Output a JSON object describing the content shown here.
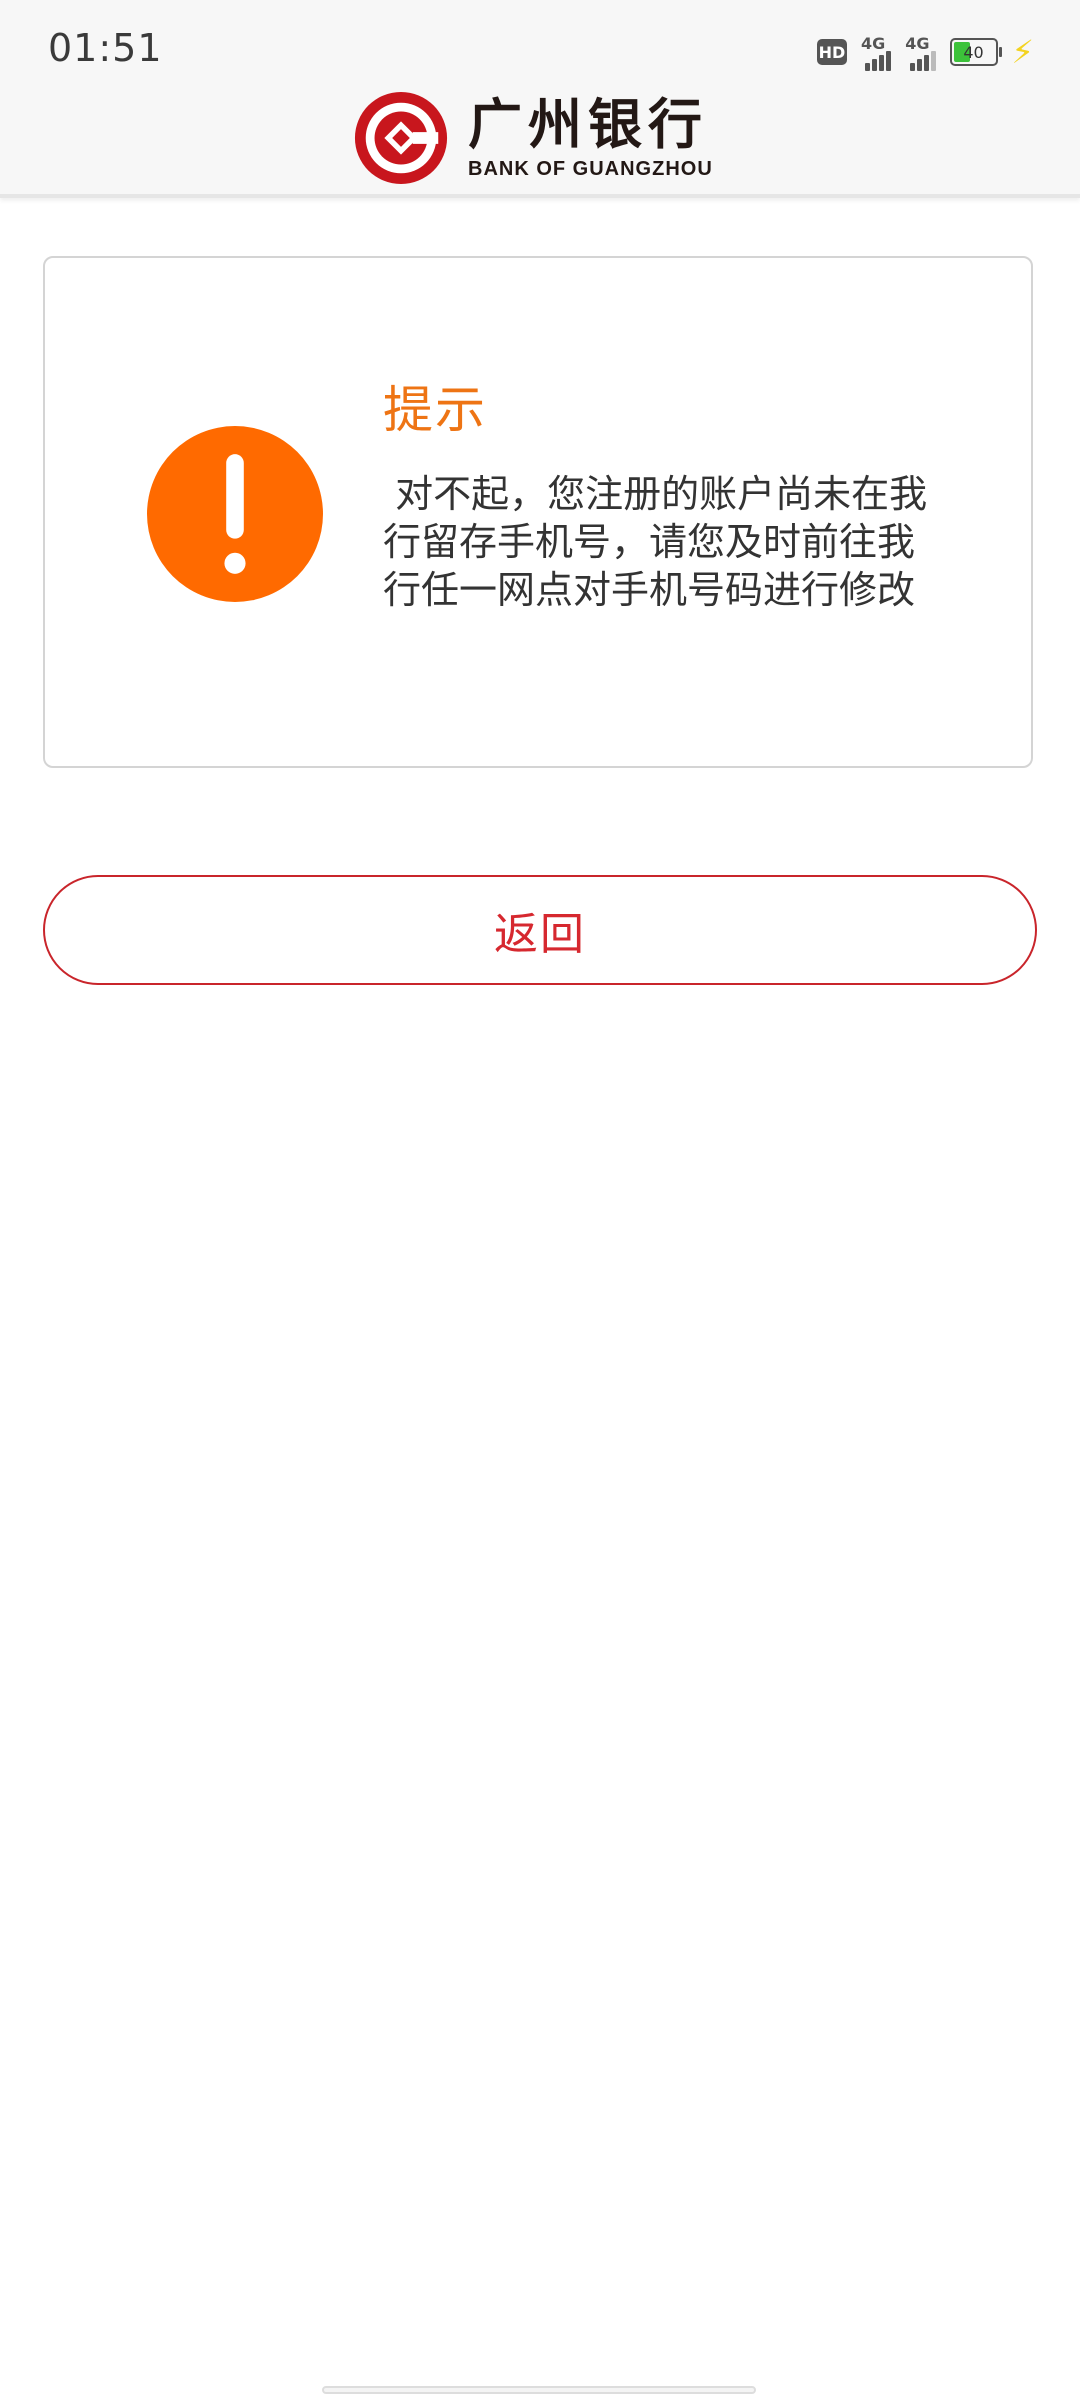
{
  "status_bar": {
    "time": "01:51",
    "hd_label": "HD",
    "network_1": "4G",
    "network_2": "4G",
    "battery": "40"
  },
  "header": {
    "bank_name_cn": "广州银行",
    "bank_name_en": "BANK OF GUANGZHOU",
    "brand_color": "#c8161d"
  },
  "notice": {
    "title": "提示",
    "message": " 对不起，您注册的账户尚未在我行留存手机号，请您及时前往我行任一网点对手机号码进行修改",
    "icon": "exclamation-icon",
    "icon_color": "#ff6a00",
    "title_color": "#ee7414"
  },
  "actions": {
    "back_label": "返回",
    "accent_color": "#d6282f"
  }
}
